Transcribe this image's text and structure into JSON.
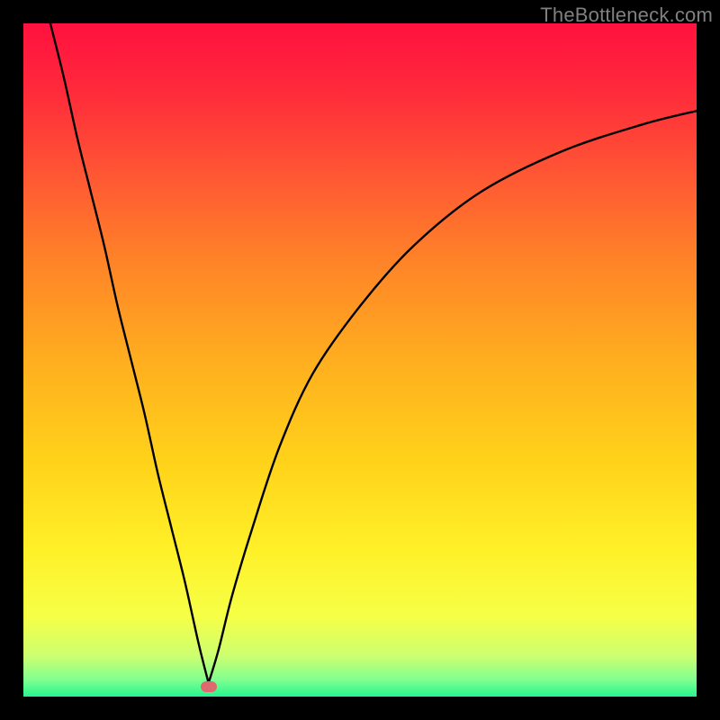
{
  "watermark": "TheBottleneck.com",
  "gradient_stops": [
    {
      "offset": 0.0,
      "color": "#ff113f"
    },
    {
      "offset": 0.1,
      "color": "#ff2a3b"
    },
    {
      "offset": 0.22,
      "color": "#ff5534"
    },
    {
      "offset": 0.35,
      "color": "#ff8228"
    },
    {
      "offset": 0.5,
      "color": "#ffae1f"
    },
    {
      "offset": 0.65,
      "color": "#ffd21a"
    },
    {
      "offset": 0.78,
      "color": "#fff028"
    },
    {
      "offset": 0.88,
      "color": "#f6ff46"
    },
    {
      "offset": 0.94,
      "color": "#ccff70"
    },
    {
      "offset": 0.975,
      "color": "#80ff90"
    },
    {
      "offset": 1.0,
      "color": "#25f58f"
    }
  ],
  "curve": {
    "color": "#000000",
    "width": 2.4
  },
  "marker": {
    "x_frac": 0.275,
    "y_frac": 0.985,
    "color": "#dd6a6e"
  },
  "chart_data": {
    "type": "line",
    "title": "",
    "xlabel": "",
    "ylabel": "",
    "xlim": [
      0,
      100
    ],
    "ylim": [
      0,
      100
    ],
    "notes": "V-shaped bottleneck curve on red→green vertical gradient. Minimum (green zone) at x≈27.5. Curve is steep/linear on the left branch and asymptotic on the right. Values are normalized 0–100 (y reads off the vertical gradient: 0 = bottom/green, 100 = top/red).",
    "series": [
      {
        "name": "bottleneck-curve",
        "x": [
          4,
          6,
          8,
          10,
          12,
          14,
          16,
          18,
          20,
          22,
          24,
          26,
          27.5,
          29,
          31,
          34,
          38,
          43,
          50,
          58,
          68,
          80,
          92,
          100
        ],
        "y": [
          100,
          92,
          83,
          75,
          67,
          58,
          50,
          42,
          33,
          25,
          17,
          8,
          2,
          7,
          15,
          25,
          37,
          48,
          58,
          67,
          75,
          81,
          85,
          87
        ]
      }
    ],
    "minimum_marker": {
      "x": 27.5,
      "y": 2
    }
  }
}
